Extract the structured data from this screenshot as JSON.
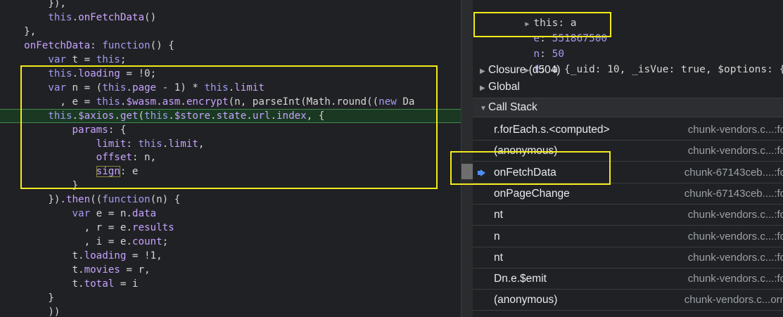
{
  "code_lines": [
    {
      "tokens": [
        {
          "t": "        }),",
          "c": "p"
        }
      ]
    },
    {
      "tokens": [
        {
          "t": "        ",
          "c": "p"
        },
        {
          "t": "this",
          "c": "k"
        },
        {
          "t": ".",
          "c": "p"
        },
        {
          "t": "onFetchData",
          "c": "f"
        },
        {
          "t": "()",
          "c": "p"
        }
      ]
    },
    {
      "tokens": [
        {
          "t": "    },",
          "c": "p"
        }
      ]
    },
    {
      "tokens": [
        {
          "t": "    ",
          "c": "p"
        },
        {
          "t": "onFetchData",
          "c": "pr"
        },
        {
          "t": ": ",
          "c": "p"
        },
        {
          "t": "function",
          "c": "k"
        },
        {
          "t": "() {",
          "c": "p"
        }
      ]
    },
    {
      "tokens": [
        {
          "t": "        ",
          "c": "p"
        },
        {
          "t": "var",
          "c": "k"
        },
        {
          "t": " t = ",
          "c": "p"
        },
        {
          "t": "this",
          "c": "k"
        },
        {
          "t": ";",
          "c": "p"
        }
      ]
    },
    {
      "tokens": [
        {
          "t": "        ",
          "c": "p"
        },
        {
          "t": "this",
          "c": "k"
        },
        {
          "t": ".",
          "c": "p"
        },
        {
          "t": "loading",
          "c": "pr"
        },
        {
          "t": " = !0;",
          "c": "p"
        }
      ]
    },
    {
      "tokens": [
        {
          "t": "        ",
          "c": "p"
        },
        {
          "t": "var",
          "c": "k"
        },
        {
          "t": " n = (",
          "c": "p"
        },
        {
          "t": "this",
          "c": "k"
        },
        {
          "t": ".",
          "c": "p"
        },
        {
          "t": "page",
          "c": "pr"
        },
        {
          "t": " - 1) * ",
          "c": "p"
        },
        {
          "t": "this",
          "c": "k"
        },
        {
          "t": ".",
          "c": "p"
        },
        {
          "t": "limit",
          "c": "pr"
        }
      ]
    },
    {
      "tokens": [
        {
          "t": "          , e = ",
          "c": "p"
        },
        {
          "t": "this",
          "c": "k"
        },
        {
          "t": ".",
          "c": "p"
        },
        {
          "t": "$wasm",
          "c": "pr"
        },
        {
          "t": ".",
          "c": "p"
        },
        {
          "t": "asm",
          "c": "pr"
        },
        {
          "t": ".",
          "c": "p"
        },
        {
          "t": "encrypt",
          "c": "pr"
        },
        {
          "t": "(n, parseInt(Math.round((",
          "c": "p"
        },
        {
          "t": "new",
          "c": "k"
        },
        {
          "t": " Da",
          "c": "p"
        }
      ]
    },
    {
      "hl": true,
      "tokens": [
        {
          "t": "        ",
          "c": "p"
        },
        {
          "t": "this",
          "c": "k"
        },
        {
          "t": ".",
          "c": "p"
        },
        {
          "t": "$axios",
          "c": "pr"
        },
        {
          "t": ".",
          "c": "p"
        },
        {
          "t": "get",
          "c": "pr"
        },
        {
          "t": "(",
          "c": "p"
        },
        {
          "t": "this",
          "c": "k"
        },
        {
          "t": ".",
          "c": "p"
        },
        {
          "t": "$store",
          "c": "pr"
        },
        {
          "t": ".",
          "c": "p"
        },
        {
          "t": "state",
          "c": "pr"
        },
        {
          "t": ".",
          "c": "p"
        },
        {
          "t": "url",
          "c": "pr"
        },
        {
          "t": ".",
          "c": "p"
        },
        {
          "t": "index",
          "c": "pr"
        },
        {
          "t": ", {",
          "c": "p"
        }
      ]
    },
    {
      "tokens": [
        {
          "t": "            ",
          "c": "p"
        },
        {
          "t": "params",
          "c": "pr"
        },
        {
          "t": ": {",
          "c": "p"
        }
      ]
    },
    {
      "tokens": [
        {
          "t": "                ",
          "c": "p"
        },
        {
          "t": "limit",
          "c": "pr"
        },
        {
          "t": ": ",
          "c": "p"
        },
        {
          "t": "this",
          "c": "k"
        },
        {
          "t": ".",
          "c": "p"
        },
        {
          "t": "limit",
          "c": "pr"
        },
        {
          "t": ",",
          "c": "p"
        }
      ]
    },
    {
      "tokens": [
        {
          "t": "                ",
          "c": "p"
        },
        {
          "t": "offset",
          "c": "pr"
        },
        {
          "t": ": n,",
          "c": "p"
        }
      ]
    },
    {
      "tokens": [
        {
          "t": "                ",
          "c": "p"
        },
        {
          "t": "sign",
          "c": "pr",
          "box": true
        },
        {
          "t": ": e",
          "c": "p"
        }
      ]
    },
    {
      "tokens": [
        {
          "t": "            }",
          "c": "p"
        }
      ]
    },
    {
      "tokens": [
        {
          "t": "        }).",
          "c": "p"
        },
        {
          "t": "then",
          "c": "pr"
        },
        {
          "t": "((",
          "c": "p"
        },
        {
          "t": "function",
          "c": "k"
        },
        {
          "t": "(n) {",
          "c": "p"
        }
      ]
    },
    {
      "tokens": [
        {
          "t": "            ",
          "c": "p"
        },
        {
          "t": "var",
          "c": "k"
        },
        {
          "t": " e = n.",
          "c": "p"
        },
        {
          "t": "data",
          "c": "pr"
        }
      ]
    },
    {
      "tokens": [
        {
          "t": "              , r = e.",
          "c": "p"
        },
        {
          "t": "results",
          "c": "pr"
        }
      ]
    },
    {
      "tokens": [
        {
          "t": "              , i = e.",
          "c": "p"
        },
        {
          "t": "count",
          "c": "pr"
        },
        {
          "t": ";",
          "c": "p"
        }
      ]
    },
    {
      "tokens": [
        {
          "t": "            t.",
          "c": "p"
        },
        {
          "t": "loading",
          "c": "pr"
        },
        {
          "t": " = !1,",
          "c": "p"
        }
      ]
    },
    {
      "tokens": [
        {
          "t": "            t.",
          "c": "p"
        },
        {
          "t": "movies",
          "c": "pr"
        },
        {
          "t": " = r,",
          "c": "p"
        }
      ]
    },
    {
      "tokens": [
        {
          "t": "            t.",
          "c": "p"
        },
        {
          "t": "total",
          "c": "pr"
        },
        {
          "t": " = i",
          "c": "p"
        }
      ]
    },
    {
      "tokens": [
        {
          "t": "        }",
          "c": "p"
        }
      ]
    },
    {
      "tokens": [
        {
          "t": "        ))",
          "c": "p"
        }
      ]
    }
  ],
  "scope": {
    "this_key": "this",
    "this_val": "a",
    "e_key": "e",
    "e_val": "551867500",
    "n_key": "n",
    "n_val": "50",
    "t_key": "t",
    "t_val": "a {_uid: 10, _isVue: true, $options: {…},",
    "closure": "Closure (d504)",
    "global": "Global"
  },
  "call_stack": {
    "title": "Call Stack",
    "frames": [
      {
        "fn": "r.forEach.s.<computed>",
        "loc": "chunk-vendors.c...:fo"
      },
      {
        "fn": "(anonymous)",
        "loc": "chunk-vendors.c...:fo"
      },
      {
        "fn": "onFetchData",
        "loc": "chunk-67143ceb....:fo",
        "current": true
      },
      {
        "fn": "onPageChange",
        "loc": "chunk-67143ceb....:fo"
      },
      {
        "fn": "nt",
        "loc": "chunk-vendors.c...:fo"
      },
      {
        "fn": "n",
        "loc": "chunk-vendors.c...:fo"
      },
      {
        "fn": "nt",
        "loc": "chunk-vendors.c...:fo"
      },
      {
        "fn": "Dn.e.$emit",
        "loc": "chunk-vendors.c...:fo"
      },
      {
        "fn": "(anonymous)",
        "loc": "chunk-vendors.c...orn"
      }
    ]
  },
  "colors": {
    "keyword": "#a29cf1",
    "property": "#c7a3ff",
    "highlight_box": "#f2ea1a",
    "current_line_bg": "#1b3823",
    "current_frame_arrow": "#4d8ef7"
  }
}
